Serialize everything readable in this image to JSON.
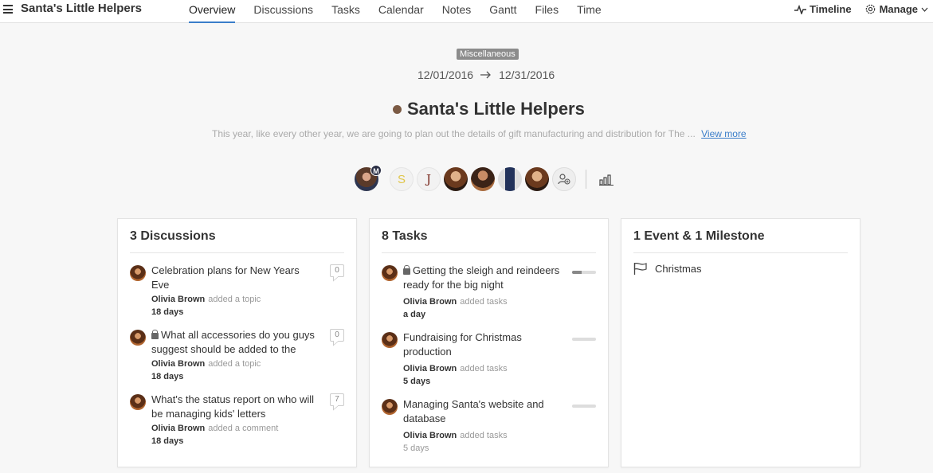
{
  "app": {
    "title": "Santa's Little Helpers"
  },
  "tabs": [
    {
      "label": "Overview",
      "active": true
    },
    {
      "label": "Discussions"
    },
    {
      "label": "Tasks"
    },
    {
      "label": "Calendar"
    },
    {
      "label": "Notes"
    },
    {
      "label": "Gantt"
    },
    {
      "label": "Files"
    },
    {
      "label": "Time"
    }
  ],
  "actions": {
    "timeline": "Timeline",
    "manage": "Manage"
  },
  "project": {
    "category": "Miscellaneous",
    "start_date": "12/01/2016",
    "end_date": "12/31/2016",
    "name": "Santa's Little Helpers",
    "color": "#7b5a44",
    "description": "This year, like every other year, we are going to plan out the details of gift manufacturing and distribution for The ...",
    "view_more": "View more"
  },
  "members": [
    {
      "type": "photo",
      "badge": "M"
    },
    {
      "type": "letter",
      "letter": "S"
    },
    {
      "type": "letter",
      "letter": "J"
    },
    {
      "type": "photo"
    },
    {
      "type": "photo"
    },
    {
      "type": "photo"
    },
    {
      "type": "photo"
    }
  ],
  "discussions": {
    "heading": "3 Discussions",
    "items": [
      {
        "title": "Celebration plans for New Years Eve",
        "author": "Olivia Brown",
        "action": "added a topic",
        "age": "18 days",
        "count": "0",
        "locked": false
      },
      {
        "title": "What all accessories do you guys suggest should be added to the",
        "author": "Olivia Brown",
        "action": "added a topic",
        "age": "18 days",
        "count": "0",
        "locked": true
      },
      {
        "title": "What's the status report on who will be managing kids' letters",
        "author": "Olivia Brown",
        "action": "added a comment",
        "age": "18 days",
        "count": "7",
        "locked": false
      }
    ]
  },
  "tasks": {
    "heading": "8 Tasks",
    "items": [
      {
        "title": "Getting the sleigh and reindeers ready for the big night",
        "author": "Olivia Brown",
        "action": "added tasks",
        "age": "a day",
        "progress": 0.4,
        "locked": true
      },
      {
        "title": "Fundraising for Christmas production",
        "author": "Olivia Brown",
        "action": "added tasks",
        "age": "5 days",
        "progress": 0,
        "locked": false
      },
      {
        "title": "Managing Santa's website and database",
        "author": "Olivia Brown",
        "action": "added tasks",
        "age": "5 days",
        "progress": 0,
        "locked": false
      }
    ]
  },
  "events": {
    "heading": "1 Event & 1 Milestone",
    "items": [
      {
        "title": "Christmas",
        "icon": "flag-icon"
      }
    ]
  },
  "colors": {
    "accent": "#3a7dc9",
    "badge": "#8c8c8c"
  }
}
